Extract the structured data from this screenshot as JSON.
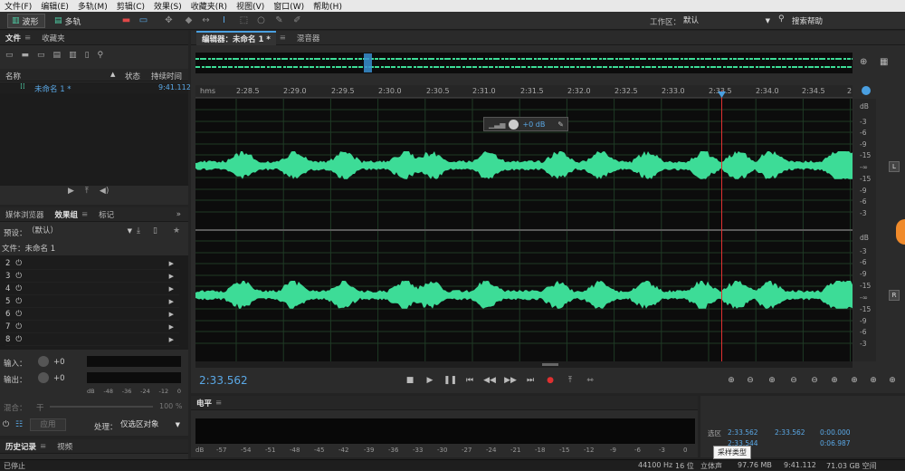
{
  "menu": [
    "文件(F)",
    "编辑(E)",
    "多轨(M)",
    "剪辑(C)",
    "效果(S)",
    "收藏夹(R)",
    "视图(V)",
    "窗口(W)",
    "帮助(H)"
  ],
  "toolbar": {
    "waveform_label": "波形",
    "multitrack_label": "多轨",
    "workspace_label": "工作区：",
    "workspace_value": "默认",
    "search_help": "搜索帮助"
  },
  "files_panel": {
    "tabs": [
      "文件",
      "收藏夹"
    ],
    "col_name": "名称",
    "col_status": "状态",
    "col_duration": "持续时间",
    "file_name": "未命名 1 *",
    "file_duration": "9:41.112"
  },
  "effects_panel": {
    "tabs": [
      "媒体浏览器",
      "效果组",
      "标记"
    ],
    "preset_label": "预设：",
    "preset_value": "（默认）",
    "file_label": "文件：未命名 1",
    "rows": [
      "2",
      "3",
      "4",
      "5",
      "6",
      "7",
      "8"
    ],
    "input_label": "输入：",
    "input_value": "+0",
    "output_label": "输出：",
    "output_value": "+0",
    "meter_scale": [
      "dB",
      "-48",
      "-36",
      "-24",
      "-12",
      "0"
    ],
    "mix_label": "混合：",
    "mix_dry": "干",
    "mix_value": "100 %",
    "apply_label": "应用",
    "process_label": "处理：",
    "process_value": "仅选区对象"
  },
  "history_panel": {
    "tabs": [
      "历史记录",
      "视频"
    ]
  },
  "editor": {
    "tab_editor": "编辑器：未命名 1 *",
    "tab_mixer": "混音器",
    "ruler_unit": "hms",
    "ruler_labels": [
      "2:28.5",
      "2:29.0",
      "2:29.5",
      "2:30.0",
      "2:30.5",
      "2:31.0",
      "2:31.5",
      "2:32.0",
      "2:32.5",
      "2:33.0",
      "2:33.5",
      "2:34.0",
      "2:34.5",
      "2"
    ],
    "hud_gain": "+0 dB",
    "db_scale_top": [
      "dB",
      "-3",
      "-6",
      "-9",
      "-15",
      "-∞",
      "-15",
      "-9",
      "-6",
      "-3"
    ],
    "db_scale_bottom": [
      "dB",
      "-3",
      "-6",
      "-9",
      "-15",
      "-∞",
      "-15",
      "-9",
      "-6",
      "-3"
    ],
    "channel_left": "L",
    "channel_right": "R",
    "timecode": "2:33.562"
  },
  "level_panel": {
    "title": "电平",
    "scale": [
      "dB",
      "-57",
      "-54",
      "-51",
      "-48",
      "-45",
      "-42",
      "-39",
      "-36",
      "-33",
      "-30",
      "-27",
      "-24",
      "-21",
      "-18",
      "-15",
      "-12",
      "-9",
      "-6",
      "-3",
      "0"
    ]
  },
  "selection_panel": {
    "selection_label": "选区",
    "start": "2:33.562",
    "end": "2:33.562",
    "duration": "0:00.000",
    "view_start": "2:33.544",
    "view_end": "0:06.987",
    "tooltip": "采样类型"
  },
  "status": {
    "left": "已停止",
    "sample_rate": "44100 Hz",
    "bit_depth": "16 位",
    "channels": "立体声",
    "file_size": "97.76 MB",
    "duration": "9:41.112",
    "free_space": "71.03 GB 空间"
  },
  "colors": {
    "waveform": "#3ddc97",
    "playhead": "#e03030",
    "accent": "#4a9fe0",
    "timecode": "#4a9fe0"
  }
}
